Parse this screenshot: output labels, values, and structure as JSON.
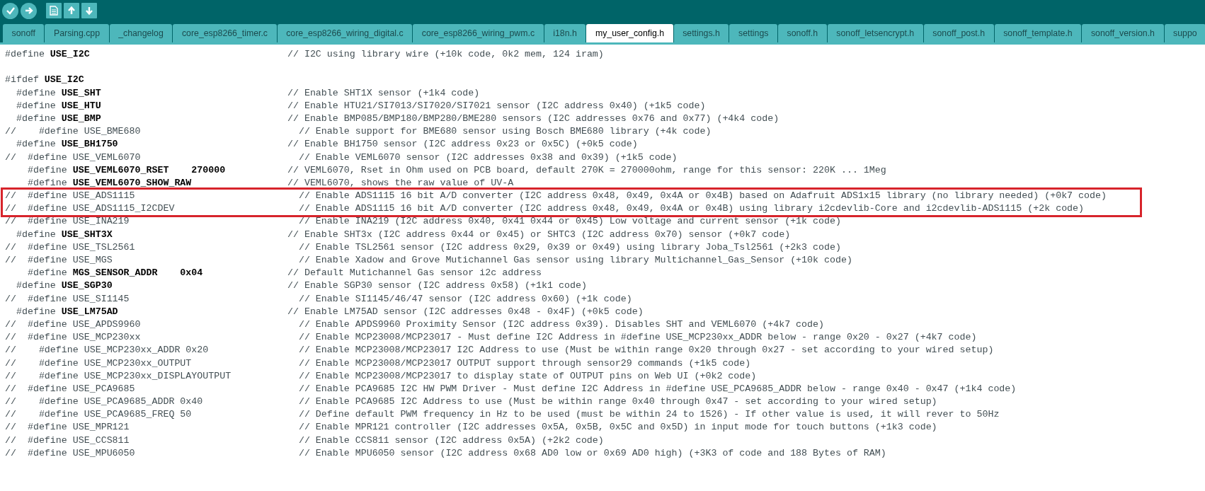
{
  "toolbar": {
    "buttons": [
      {
        "kind": "verify"
      },
      {
        "kind": "upload"
      },
      {
        "kind": "new"
      },
      {
        "kind": "open"
      },
      {
        "kind": "save"
      }
    ]
  },
  "tabs": [
    {
      "label": "sonoff",
      "selected": false
    },
    {
      "label": "Parsing.cpp",
      "selected": false
    },
    {
      "label": "_changelog",
      "selected": false
    },
    {
      "label": "core_esp8266_timer.c",
      "selected": false
    },
    {
      "label": "core_esp8266_wiring_digital.c",
      "selected": false
    },
    {
      "label": "core_esp8266_wiring_pwm.c",
      "selected": false
    },
    {
      "label": "i18n.h",
      "selected": false
    },
    {
      "label": "my_user_config.h",
      "selected": true
    },
    {
      "label": "settings.h",
      "selected": false
    },
    {
      "label": "settings",
      "selected": false
    },
    {
      "label": "sonoff.h",
      "selected": false
    },
    {
      "label": "sonoff_letsencrypt.h",
      "selected": false
    },
    {
      "label": "sonoff_post.h",
      "selected": false
    },
    {
      "label": "sonoff_template.h",
      "selected": false
    },
    {
      "label": "sonoff_version.h",
      "selected": false
    },
    {
      "label": "suppo",
      "selected": false
    }
  ],
  "lines": [
    {
      "kind": "active",
      "code": "#define **USE_I2C**",
      "comment": "// I2C using library wire (+10k code, 0k2 mem, 124 iram)",
      "highlighted": false
    },
    {
      "kind": "blank",
      "highlighted": false
    },
    {
      "kind": "active",
      "code": "#ifdef **USE_I2C**",
      "highlighted": false
    },
    {
      "kind": "active",
      "code": "  #define **USE_SHT**",
      "comment": "// Enable SHT1X sensor (+1k4 code)",
      "highlighted": false
    },
    {
      "kind": "active",
      "code": "  #define **USE_HTU**",
      "comment": "// Enable HTU21/SI7013/SI7020/SI7021 sensor (I2C address 0x40) (+1k5 code)",
      "highlighted": false
    },
    {
      "kind": "active",
      "code": "  #define **USE_BMP**",
      "comment": "// Enable BMP085/BMP180/BMP280/BME280 sensors (I2C addresses 0x76 and 0x77) (+4k4 code)",
      "highlighted": false
    },
    {
      "kind": "disabled",
      "code": "//    #define USE_BME680",
      "comment": "// Enable support for BME680 sensor using Bosch BME680 library (+4k code)",
      "highlighted": false
    },
    {
      "kind": "active",
      "code": "  #define **USE_BH1750**",
      "comment": "// Enable BH1750 sensor (I2C address 0x23 or 0x5C) (+0k5 code)",
      "highlighted": false
    },
    {
      "kind": "disabled",
      "code": "//  #define USE_VEML6070",
      "comment": "// Enable VEML6070 sensor (I2C addresses 0x38 and 0x39) (+1k5 code)",
      "highlighted": false
    },
    {
      "kind": "active",
      "code": "    #define **USE_VEML6070_RSET    270000**",
      "comment": "// VEML6070, Rset in Ohm used on PCB board, default 270K = 270000ohm, range for this sensor: 220K ... 1Meg",
      "highlighted": false
    },
    {
      "kind": "active",
      "code": "    #define **USE_VEML6070_SHOW_RAW**",
      "comment": "// VEML6070, shows the raw value of UV-A",
      "highlighted": false
    },
    {
      "kind": "disabled",
      "code": "//  #define USE_ADS1115",
      "comment": "// Enable ADS1115 16 bit A/D converter (I2C address 0x48, 0x49, 0x4A or 0x4B) based on Adafruit ADS1x15 library (no library needed) (+0k7 code)",
      "highlighted": true
    },
    {
      "kind": "disabled",
      "code": "//  #define USE_ADS1115_I2CDEV",
      "comment": "// Enable ADS1115 16 bit A/D converter (I2C address 0x48, 0x49, 0x4A or 0x4B) using library i2cdevlib-Core and i2cdevlib-ADS1115 (+2k code)",
      "highlighted": true
    },
    {
      "kind": "disabled",
      "code": "//  #define USE_INA219",
      "comment": "// Enable INA219 (I2C address 0x40, 0x41 0x44 or 0x45) Low voltage and current sensor (+1k code)",
      "highlighted": false
    },
    {
      "kind": "active",
      "code": "  #define **USE_SHT3X**",
      "comment": "// Enable SHT3x (I2C address 0x44 or 0x45) or SHTC3 (I2C address 0x70) sensor (+0k7 code)",
      "highlighted": false
    },
    {
      "kind": "disabled",
      "code": "//  #define USE_TSL2561",
      "comment": "// Enable TSL2561 sensor (I2C address 0x29, 0x39 or 0x49) using library Joba_Tsl2561 (+2k3 code)",
      "highlighted": false
    },
    {
      "kind": "disabled",
      "code": "//  #define USE_MGS",
      "comment": "// Enable Xadow and Grove Mutichannel Gas sensor using library Multichannel_Gas_Sensor (+10k code)",
      "highlighted": false
    },
    {
      "kind": "active",
      "code": "    #define **MGS_SENSOR_ADDR    0x04**",
      "comment": "// Default Mutichannel Gas sensor i2c address",
      "highlighted": false
    },
    {
      "kind": "active",
      "code": "  #define **USE_SGP30**",
      "comment": "// Enable SGP30 sensor (I2C address 0x58) (+1k1 code)",
      "highlighted": false
    },
    {
      "kind": "disabled",
      "code": "//  #define USE_SI1145",
      "comment": "// Enable SI1145/46/47 sensor (I2C address 0x60) (+1k code)",
      "highlighted": false
    },
    {
      "kind": "active",
      "code": "  #define **USE_LM75AD**",
      "comment": "// Enable LM75AD sensor (I2C addresses 0x48 - 0x4F) (+0k5 code)",
      "highlighted": false
    },
    {
      "kind": "disabled",
      "code": "//  #define USE_APDS9960",
      "comment": "// Enable APDS9960 Proximity Sensor (I2C address 0x39). Disables SHT and VEML6070 (+4k7 code)",
      "highlighted": false
    },
    {
      "kind": "disabled",
      "code": "//  #define USE_MCP230xx",
      "comment": "// Enable MCP23008/MCP23017 - Must define I2C Address in #define USE_MCP230xx_ADDR below - range 0x20 - 0x27 (+4k7 code)",
      "highlighted": false
    },
    {
      "kind": "disabled",
      "code": "//    #define USE_MCP230xx_ADDR 0x20",
      "comment": "// Enable MCP23008/MCP23017 I2C Address to use (Must be within range 0x20 through 0x27 - set according to your wired setup)",
      "highlighted": false
    },
    {
      "kind": "disabled",
      "code": "//    #define USE_MCP230xx_OUTPUT",
      "comment": "// Enable MCP23008/MCP23017 OUTPUT support through sensor29 commands (+1k5 code)",
      "highlighted": false
    },
    {
      "kind": "disabled",
      "code": "//    #define USE_MCP230xx_DISPLAYOUTPUT",
      "comment": "// Enable MCP23008/MCP23017 to display state of OUTPUT pins on Web UI (+0k2 code)",
      "highlighted": false
    },
    {
      "kind": "disabled",
      "code": "//  #define USE_PCA9685",
      "comment": "// Enable PCA9685 I2C HW PWM Driver - Must define I2C Address in #define USE_PCA9685_ADDR below - range 0x40 - 0x47 (+1k4 code)",
      "highlighted": false
    },
    {
      "kind": "disabled",
      "code": "//    #define USE_PCA9685_ADDR 0x40",
      "comment": "// Enable PCA9685 I2C Address to use (Must be within range 0x40 through 0x47 - set according to your wired setup)",
      "highlighted": false
    },
    {
      "kind": "disabled",
      "code": "//    #define USE_PCA9685_FREQ 50",
      "comment": "// Define default PWM frequency in Hz to be used (must be within 24 to 1526) - If other value is used, it will rever to 50Hz",
      "highlighted": false
    },
    {
      "kind": "disabled",
      "code": "//  #define USE_MPR121",
      "comment": "// Enable MPR121 controller (I2C addresses 0x5A, 0x5B, 0x5C and 0x5D) in input mode for touch buttons (+1k3 code)",
      "highlighted": false
    },
    {
      "kind": "disabled",
      "code": "//  #define USE_CCS811",
      "comment": "// Enable CCS811 sensor (I2C address 0x5A) (+2k2 code)",
      "highlighted": false
    },
    {
      "kind": "disabled",
      "code": "//  #define USE_MPU6050",
      "comment": "// Enable MPU6050 sensor (I2C address 0x68 AD0 low or 0x69 AD0 high) (+3K3 of code and 188 Bytes of RAM)",
      "highlighted": false
    }
  ]
}
